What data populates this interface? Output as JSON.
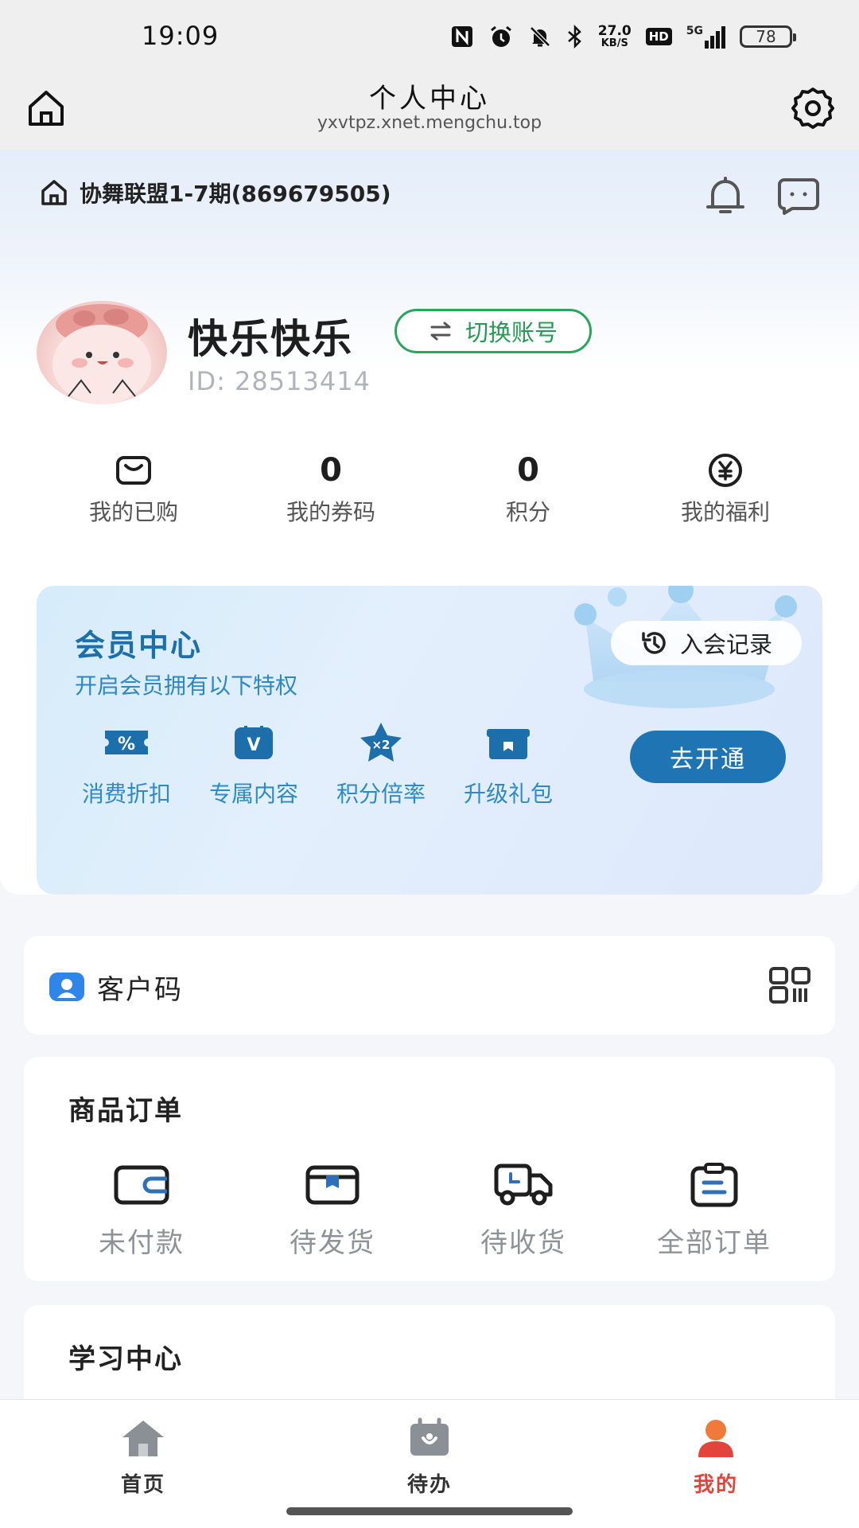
{
  "status_bar": {
    "time": "19:09",
    "net_speed_value": "27.0",
    "net_speed_unit": "KB/S",
    "hd_label": "HD",
    "network_type": "5G",
    "battery": "78"
  },
  "title_bar": {
    "title": "个人中心",
    "url": "yxvtpz.xnet.mengchu.top"
  },
  "group": {
    "name": "协舞联盟1-7期(869679505)"
  },
  "profile": {
    "name": "快乐快乐",
    "switch_label": "切换账号",
    "id_text": "ID: 28513414"
  },
  "stats": [
    {
      "label": "我的已购"
    },
    {
      "value": "0",
      "label": "我的券码"
    },
    {
      "value": "0",
      "label": "积分"
    },
    {
      "label": "我的福利"
    }
  ],
  "vip": {
    "title": "会员中心",
    "subtitle": "开启会员拥有以下特权",
    "history_label": "入会记录",
    "open_label": "去开通",
    "benefits": [
      {
        "label": "消费折扣",
        "icon": "percent-ticket-icon"
      },
      {
        "label": "专属内容",
        "icon": "v-badge-icon"
      },
      {
        "label": "积分倍率",
        "icon": "x2-star-icon"
      },
      {
        "label": "升级礼包",
        "icon": "gift-box-icon"
      }
    ],
    "accent": "#1f74b4"
  },
  "customer_code": {
    "label": "客户码"
  },
  "orders": {
    "title": "商品订单",
    "items": [
      {
        "label": "未付款",
        "icon": "wallet-icon"
      },
      {
        "label": "待发货",
        "icon": "package-icon"
      },
      {
        "label": "待收货",
        "icon": "truck-icon"
      },
      {
        "label": "全部订单",
        "icon": "clipboard-icon"
      }
    ]
  },
  "study": {
    "title": "学习中心"
  },
  "tabs": [
    {
      "label": "首页",
      "icon": "home-icon"
    },
    {
      "label": "待办",
      "icon": "calendar-icon"
    },
    {
      "label": "我的",
      "icon": "user-icon",
      "active": true
    }
  ],
  "colors": {
    "active_tab": "#e2433a",
    "switch_green": "#2aa55c"
  }
}
